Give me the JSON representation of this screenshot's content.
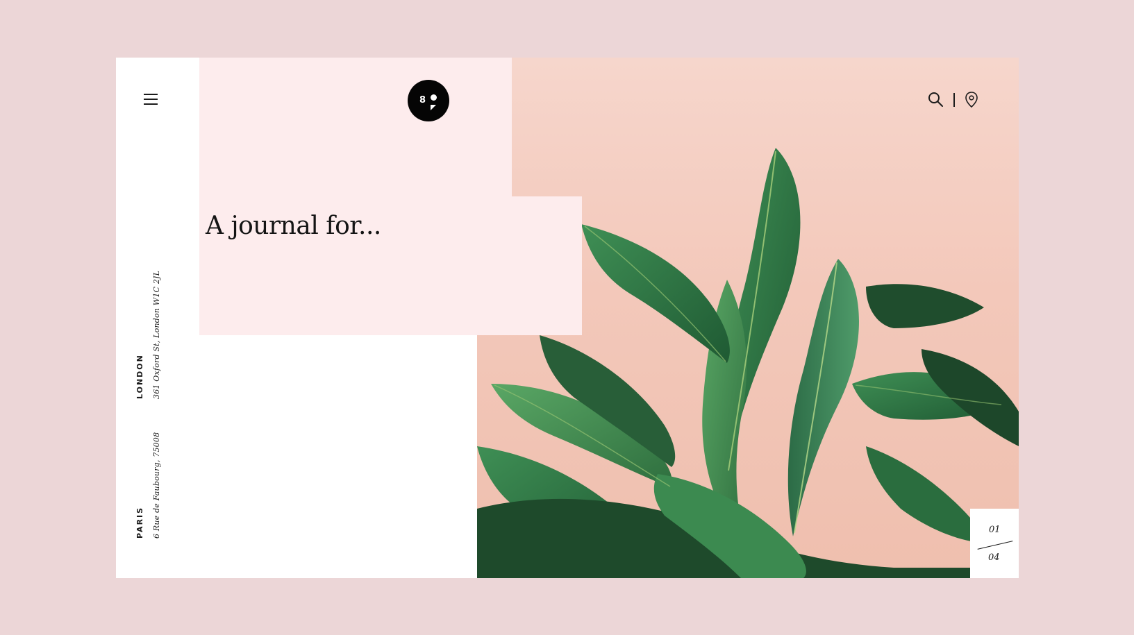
{
  "header": {
    "menu_icon": "hamburger-menu-icon",
    "logo": {
      "number": "8",
      "icon": "speech-bubble-logo"
    },
    "tools": {
      "search_icon": "search-icon",
      "location_icon": "map-pin-icon"
    }
  },
  "hero": {
    "headline": "A journal for...",
    "image": "banana-leaf-plant-photo"
  },
  "addresses": [
    {
      "city": "LONDON",
      "street": "361 Oxford St, London W1C 2JL"
    },
    {
      "city": "PARIS",
      "street": "6 Rue de Faubourg, 75008"
    }
  ],
  "pagination": {
    "current": "01",
    "total": "04"
  },
  "colors": {
    "page_background": "#ecd6d7",
    "panel_pink": "#fdeced",
    "wall_peach": "#f3c8ba",
    "leaf_green": "#2f7a45",
    "ink": "#141414"
  }
}
